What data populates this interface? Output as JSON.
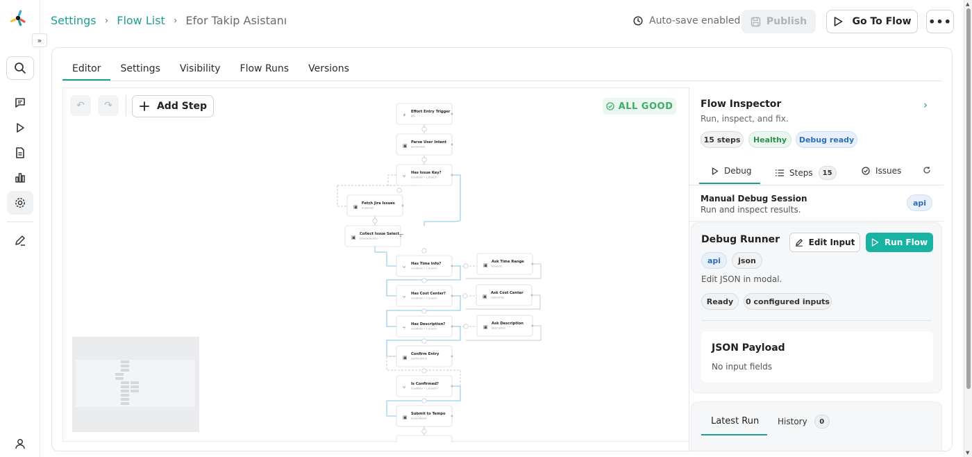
{
  "breadcrumb": {
    "items": [
      "Settings",
      "Flow List"
    ],
    "current": "Efor Takip Asistanı"
  },
  "header": {
    "autosave": "Auto-save enabled",
    "publish": "Publish",
    "go_to_flow": "Go To Flow"
  },
  "tabs": [
    "Editor",
    "Settings",
    "Visibility",
    "Flow Runs",
    "Versions"
  ],
  "canvas": {
    "add_step": "Add Step",
    "status": "ALL GOOD",
    "nodes": [
      {
        "title": "Effort Entry Trigger",
        "sub": "API"
      },
      {
        "title": "Parse User Intent",
        "sub": "parseIntent"
      },
      {
        "title": "Has Issue Key?",
        "sub": "Condition • 1 branch"
      },
      {
        "title": "Fetch Jira Issues",
        "sub": "jiraIssues"
      },
      {
        "title": "Collect Issue Select...",
        "sub": "issueSelection"
      },
      {
        "title": "Has Time Info?",
        "sub": "Condition • 1 branch"
      },
      {
        "title": "Ask Time Range",
        "sub": "timeInfo"
      },
      {
        "title": "Has Cost Center?",
        "sub": "Condition • 1 branch"
      },
      {
        "title": "Ask Cost Center",
        "sub": "costCenter"
      },
      {
        "title": "Has Description?",
        "sub": "Condition • 1 branch"
      },
      {
        "title": "Ask Description",
        "sub": "description"
      },
      {
        "title": "Confirm Entry",
        "sub": "confirmEntry"
      },
      {
        "title": "Is Confirmed?",
        "sub": "Condition • 1 branch"
      },
      {
        "title": "Submit to Tempo",
        "sub": "tempoResult"
      }
    ]
  },
  "inspector": {
    "title": "Flow Inspector",
    "subtitle": "Run, inspect, and fix.",
    "chips": [
      "15 steps",
      "Healthy",
      "Debug ready"
    ],
    "tabs": {
      "debug": "Debug",
      "steps": "Steps",
      "steps_count": "15",
      "issues": "Issues"
    },
    "session": {
      "title": "Manual Debug Session",
      "subtitle": "Run and inspect results.",
      "badge": "api"
    },
    "runner": {
      "title": "Debug Runner",
      "edit_input": "Edit Input",
      "run_flow": "Run Flow",
      "tags": [
        "api",
        "json"
      ],
      "note": "Edit JSON in modal.",
      "status": [
        "Ready",
        "0 configured inputs"
      ]
    },
    "payload": {
      "title": "JSON Payload",
      "empty": "No input fields"
    },
    "latest": {
      "tab": "Latest Run",
      "history": "History",
      "history_count": "0"
    }
  },
  "colors": {
    "accent": "#1e9e94",
    "run_button": "#19b3a3",
    "good": "#3fae6a"
  }
}
